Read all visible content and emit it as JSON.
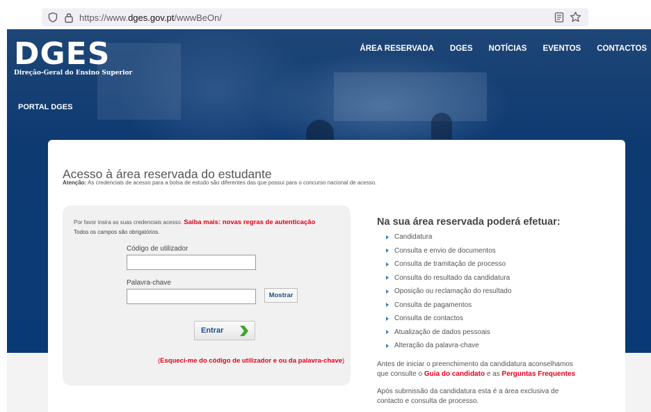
{
  "browser": {
    "url_prefix": "https://www.",
    "url_host": "dges.gov.pt",
    "url_path": "/wwwBeOn/"
  },
  "header": {
    "logo_text": "DGES",
    "logo_subtitle": "Direção-Geral do Ensino Superior",
    "nav": [
      "ÁREA RESERVADA",
      "DGES",
      "NOTÍCIAS",
      "EVENTOS",
      "CONTACTOS"
    ],
    "portal_label": "PORTAL DGES"
  },
  "main": {
    "title": "Acesso à área reservada do estudante",
    "notice_label": "Atenção:",
    "notice_text": " As credenciais de acesso para a bolsa de estudo são diferentes das que possui para o concurso nacional de acesso."
  },
  "login": {
    "intro": "Por favor insira as suas credenciais acesso.",
    "learn_more": "Saiba mais: novas regras de autenticação",
    "required": "Todos os campos são obrigatórios.",
    "username_label": "Código de utilizador",
    "username_value": "",
    "password_label": "Palavra-chave",
    "password_value": "",
    "show_button": "Mostrar",
    "submit_button": "Entrar",
    "forgot_open": "(",
    "forgot_link": "Esqueci-me do código de utilizador e ou da palavra-chave",
    "forgot_close": ")"
  },
  "sidebar": {
    "title": "Na sua área reservada poderá efetuar:",
    "items": [
      "Candidatura",
      "Consulta e envio de documentos",
      "Consulta de tramitação de processo",
      "Consulta do resultado da candidatura",
      "Oposição ou reclamação do resultado",
      "Consulta de pagamentos",
      "Consulta de contactos",
      "Atualização de dados pessoais",
      "Alteração da palavra-chave"
    ],
    "advice_part1": "Antes de iniciar o preenchimento da candidatura aconselhamos que consulte o ",
    "advice_link1": "Guia do candidato",
    "advice_part2": " e as ",
    "advice_link2": "Perguntas Frequentes",
    "after_submit": "Após submissão da candidatura esta é a área exclusiva de contacto e consulta de processo."
  },
  "colors": {
    "header_blue": "#0a3a75",
    "link_red": "#e1001a",
    "button_text_blue": "#1d4f86",
    "bullet_blue": "#2f7fc6"
  }
}
